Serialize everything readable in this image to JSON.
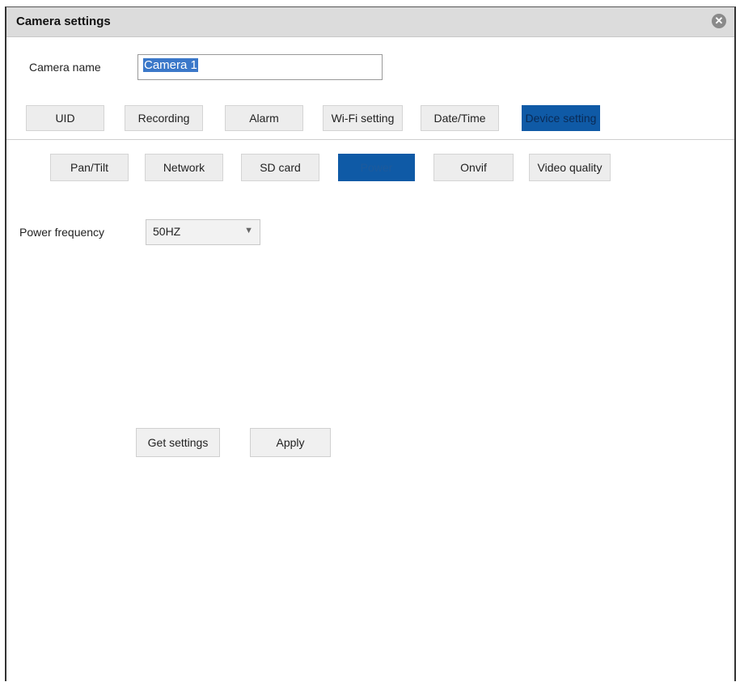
{
  "window": {
    "title": "Camera settings"
  },
  "camera_name": {
    "label": "Camera name",
    "value": "Camera 1"
  },
  "tabs": [
    {
      "label": "UID"
    },
    {
      "label": "Recording"
    },
    {
      "label": "Alarm"
    },
    {
      "label": "Wi-Fi setting"
    },
    {
      "label": "Date/Time"
    },
    {
      "label": "Device setting",
      "active": true
    }
  ],
  "subtabs": [
    {
      "label": "Pan/Tilt"
    },
    {
      "label": "Network"
    },
    {
      "label": "SD card"
    },
    {
      "label": "Power",
      "active": true
    },
    {
      "label": "Onvif"
    },
    {
      "label": "Video quality"
    }
  ],
  "power_frequency": {
    "label": "Power frequency",
    "selected": "50HZ"
  },
  "buttons": {
    "get_settings": "Get settings",
    "apply": "Apply"
  },
  "icons": {
    "close": "close-icon",
    "dropdown": "chevron-down-icon"
  },
  "colors": {
    "accent": "#0f5aa6",
    "titlebar": "#dcdcdc"
  }
}
